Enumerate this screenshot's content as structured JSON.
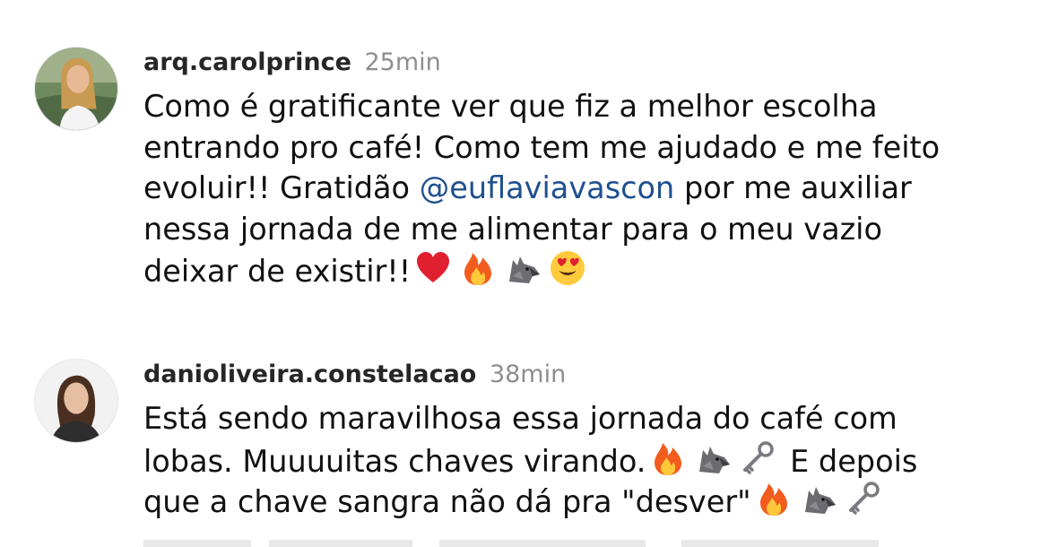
{
  "comments": [
    {
      "username": "arq.carolprince",
      "time": "25min",
      "lines": [
        "Como é gratificante ver que fiz a melhor escolha",
        "entrando pro café! Como tem me ajudado e me feito",
        "evoluir!! Gratidão ",
        "nessa jornada de me alimentar para o meu vazio",
        "deixar de existir!!"
      ],
      "mention": "@euflaviavascon",
      "after_mention": " por me auxiliar",
      "emojis": [
        "red-heart-icon",
        "fire-icon",
        "wolf-icon",
        "heart-eyes-face-icon"
      ]
    },
    {
      "username": "danioliveira.constelacao",
      "time": "38min",
      "lines": [
        "Está sendo maravilhosa essa jornada do café com",
        "lobas. Muuuuitas chaves virando.",
        " E depois",
        "que a chave sangra não dá pra \"desver\""
      ],
      "emojis_line2": [
        "fire-icon",
        "wolf-icon",
        "old-key-icon"
      ],
      "emojis_line3": [
        "fire-icon",
        "wolf-icon",
        "old-key-icon"
      ]
    }
  ],
  "colors": {
    "mention": "#1f4f8f",
    "time": "#8e8e8e",
    "username": "#262626"
  }
}
